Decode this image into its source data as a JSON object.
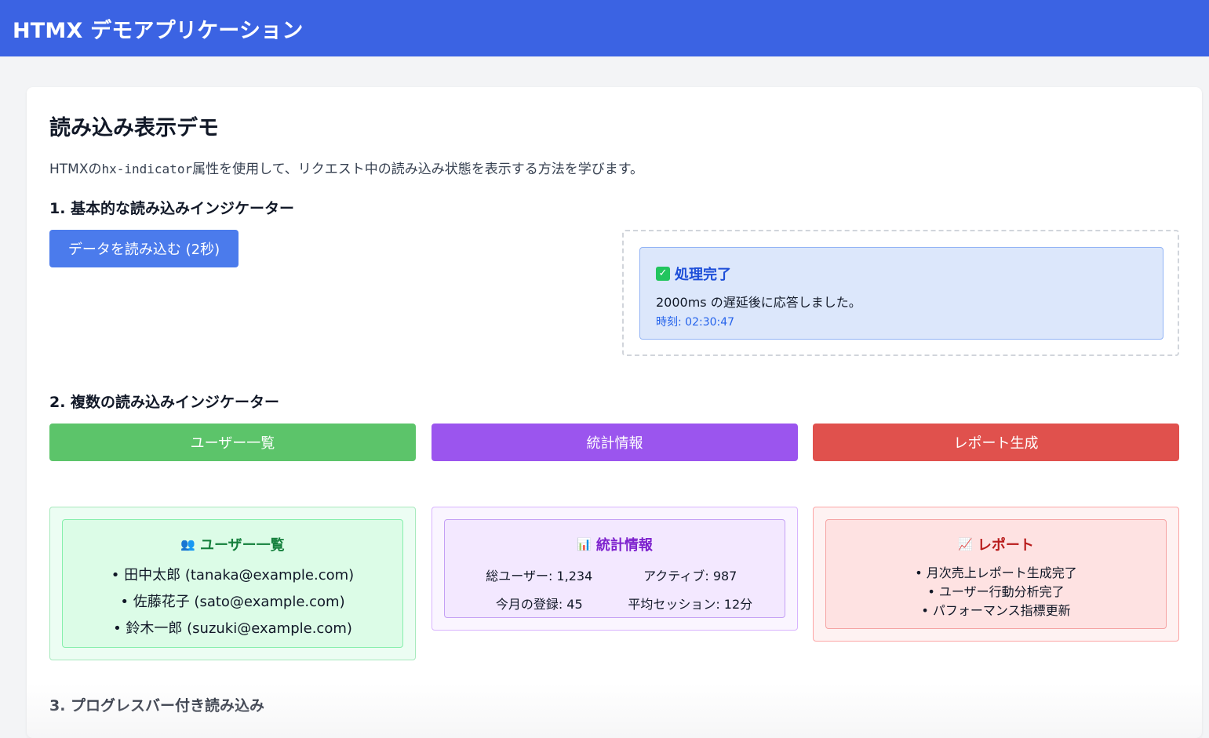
{
  "header": {
    "title": "HTMX デモアプリケーション"
  },
  "main": {
    "title": "読み込み表示デモ",
    "description_pre": "HTMXの",
    "description_code": "hx-indicator",
    "description_post": "属性を使用して、リクエスト中の読み込み状態を表示する方法を学びます。",
    "section1": {
      "heading": "1. 基本的な読み込みインジケーター",
      "button_label": "データを読み込む (2秒)",
      "result": {
        "title": "処理完了",
        "message": "2000ms の遅延後に応答しました。",
        "time": "時刻: 02:30:47"
      }
    },
    "section2": {
      "heading": "2. 複数の読み込みインジケーター",
      "buttons": [
        "ユーザー一覧",
        "統計情報",
        "レポート生成"
      ],
      "users_panel": {
        "icon": "👥",
        "title": "ユーザー一覧",
        "items": [
          "• 田中太郎 (tanaka@example.com)",
          "• 佐藤花子 (sato@example.com)",
          "• 鈴木一郎 (suzuki@example.com)"
        ]
      },
      "stats_panel": {
        "icon": "📊",
        "title": "統計情報",
        "stats": [
          "総ユーザー: 1,234",
          "アクティブ: 987",
          "今月の登録: 45",
          "平均セッション: 12分"
        ]
      },
      "report_panel": {
        "icon": "📈",
        "title": "レポート",
        "items": [
          "• 月次売上レポート生成完了",
          "• ユーザー行動分析完了",
          "• パフォーマンス指標更新"
        ]
      }
    },
    "section3": {
      "heading": "3. プログレスバー付き読み込み"
    }
  },
  "colors": {
    "header": "#3b63e3",
    "primary_button": "#4b7bec",
    "green": "#5cc46a",
    "purple": "#9b55ee",
    "red": "#e0514d"
  }
}
